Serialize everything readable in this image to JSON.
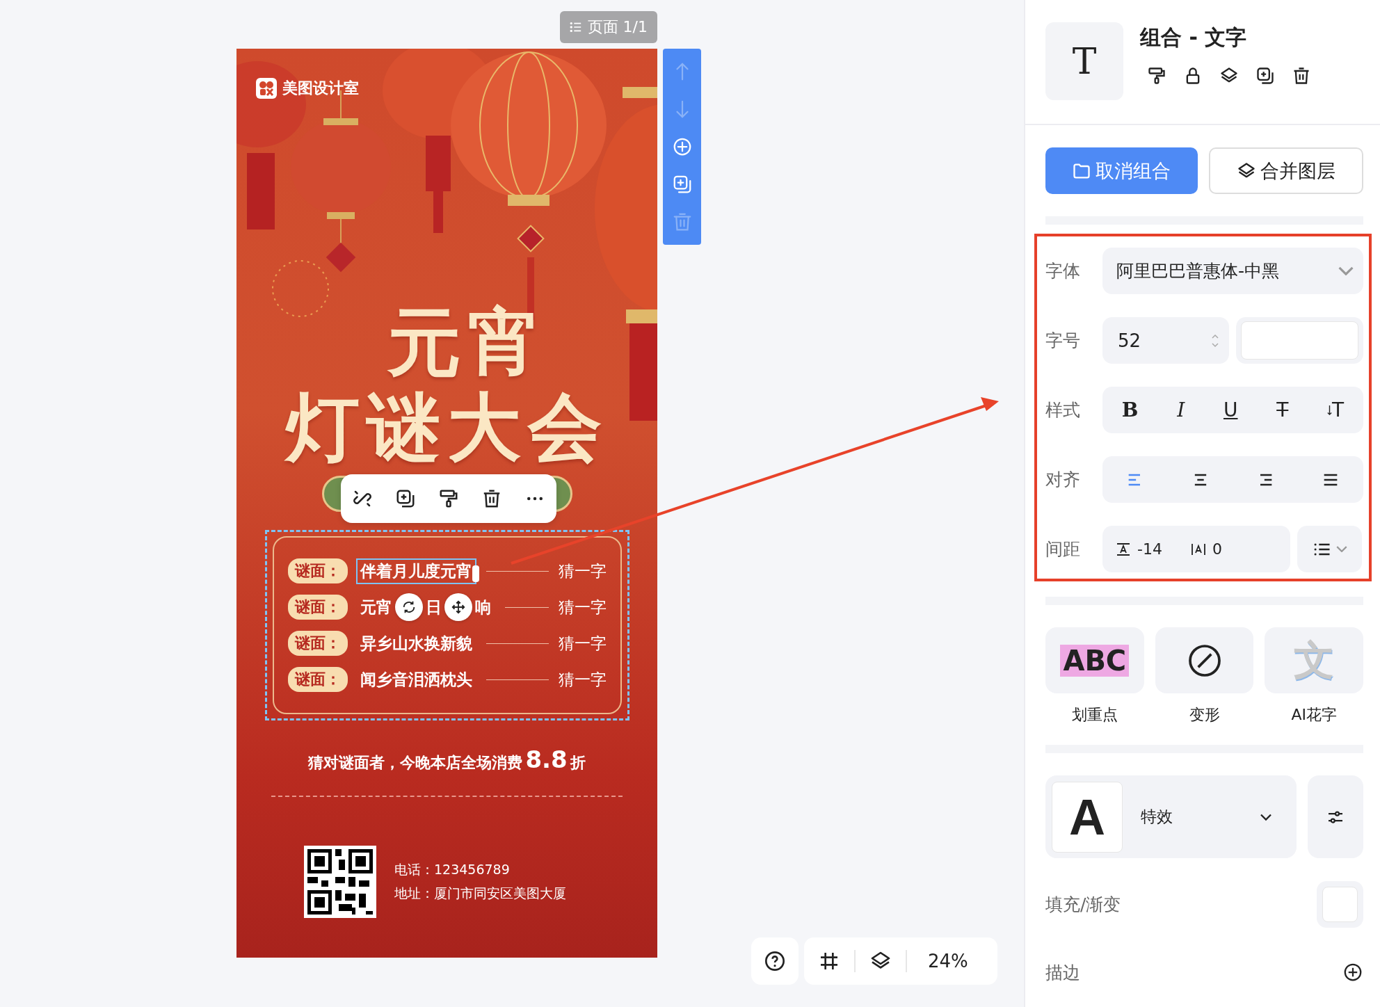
{
  "canvas": {
    "page_indicator": "页面 1/1"
  },
  "side_toolbar": [
    {
      "kind": "up",
      "disabled": true
    },
    {
      "kind": "down",
      "disabled": true
    },
    {
      "kind": "add",
      "disabled": false
    },
    {
      "kind": "duplicate",
      "disabled": false
    },
    {
      "kind": "delete",
      "disabled": true
    }
  ],
  "poster": {
    "brand": "美图设计室",
    "title_lines": [
      "元宵",
      "灯谜大会"
    ],
    "riddles": [
      {
        "tag": "谜面：",
        "parts": [
          "伴着月儿度元宵"
        ],
        "answer": "猜一字",
        "selected": true
      },
      {
        "tag": "谜面：",
        "parts": [
          "元宵",
          "日",
          "响"
        ],
        "answer": "猜一字",
        "selected": false
      },
      {
        "tag": "谜面：",
        "parts": [
          "异乡山水换新貌"
        ],
        "answer": "猜一字",
        "selected": false
      },
      {
        "tag": "谜面：",
        "parts": [
          "闻乡音泪洒枕头"
        ],
        "answer": "猜一字",
        "selected": false
      }
    ],
    "promo": {
      "text": "猜对谜面者，今晚本店全场消费",
      "highlight": "8.8",
      "suffix": "折"
    },
    "contact": [
      "电话：123456789",
      "地址：厦门市同安区美图大厦"
    ]
  },
  "bottom_bar": {
    "zoom": "24%"
  },
  "panel": {
    "preview": "T",
    "title": "组合 - 文字",
    "actions": [
      {
        "label": "取消组合",
        "kind": "primary"
      },
      {
        "label": "合并图层",
        "kind": "secondary"
      }
    ],
    "font": {
      "label": "字体",
      "value": "阿里巴巴普惠体-中黑"
    },
    "size": {
      "label": "字号",
      "value": "52"
    },
    "style": {
      "label": "样式",
      "buttons": [
        {
          "kind": "bold",
          "glyph": "B"
        },
        {
          "kind": "italic",
          "glyph": "I"
        },
        {
          "kind": "underline",
          "glyph": "U"
        },
        {
          "kind": "strike",
          "glyph": "T"
        },
        {
          "kind": "vertical",
          "glyph": "T"
        }
      ]
    },
    "align": {
      "label": "对齐",
      "options": [
        {
          "kind": "left",
          "selected": true
        },
        {
          "kind": "center",
          "selected": false
        },
        {
          "kind": "right",
          "selected": false
        },
        {
          "kind": "justify",
          "selected": false
        }
      ]
    },
    "spacing": {
      "label": "间距",
      "letter": "-14",
      "line": "0"
    },
    "effects": [
      {
        "kind": "highlight",
        "label": "划重点",
        "art": "ABC"
      },
      {
        "kind": "warp",
        "label": "变形"
      },
      {
        "kind": "ai",
        "label": "AI花字",
        "art": "文"
      }
    ],
    "effect_select": {
      "preview": "A",
      "value": "特效"
    },
    "fill": {
      "label": "填充/渐变"
    },
    "stroke": {
      "label": "描边"
    }
  }
}
